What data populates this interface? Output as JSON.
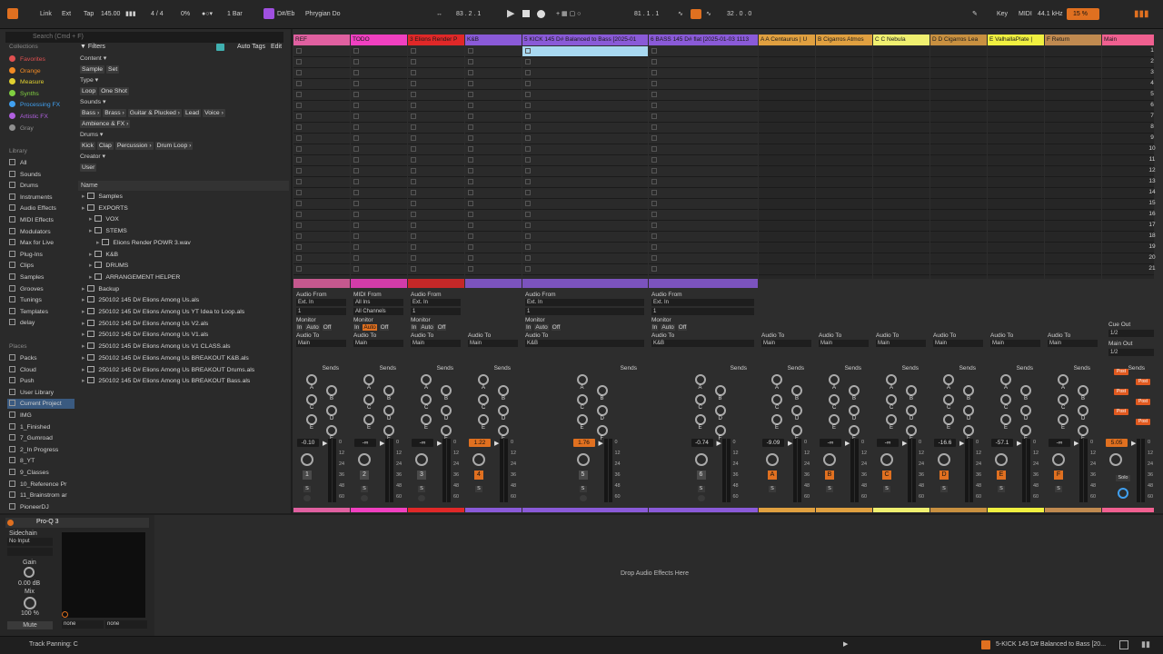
{
  "transport": {
    "link": "Link",
    "ext": "Ext",
    "tap": "Tap",
    "tempo": "145.00",
    "time_sig": "4 / 4",
    "cpu_pct": "0%",
    "quant": "1 Bar",
    "key": "D#/Eb",
    "scale": "Phrygian Do",
    "arr_pos": "83 .  2 .  1",
    "loop_start": "81 .  1 .  1",
    "loop_len": "32 .  0 .  0",
    "key_btn": "Key",
    "midi_btn": "MIDI",
    "sample_rate": "44.1 kHz",
    "cpu_load": "15 %"
  },
  "browser": {
    "search_placeholder": "Search (Cmd + F)",
    "collections_title": "Collections",
    "collections": [
      {
        "label": "Favorites",
        "color": "#e05050"
      },
      {
        "label": "Orange",
        "color": "#f08a24"
      },
      {
        "label": "Measure",
        "color": "#e0d030"
      },
      {
        "label": "Synths",
        "color": "#80d040"
      },
      {
        "label": "Processing FX",
        "color": "#40a0f0"
      },
      {
        "label": "Artistic FX",
        "color": "#b060e0"
      },
      {
        "label": "Gray",
        "color": "#909090"
      }
    ],
    "library_title": "Library",
    "library": [
      "All",
      "Sounds",
      "Drums",
      "Instruments",
      "Audio Effects",
      "MIDI Effects",
      "Modulators",
      "Max for Live",
      "Plug-Ins",
      "Clips",
      "Samples",
      "Grooves",
      "Tunings",
      "Templates",
      "delay"
    ],
    "places_title": "Places",
    "places": [
      "Packs",
      "Cloud",
      "Push",
      "User Library",
      "Current Project",
      "IMG",
      "1_Finished",
      "7_Gumroad",
      "2_In Progress",
      "8_YT",
      "9_Classes",
      "10_Reference Pr",
      "11_Brainstrom ar",
      "PioneerDJ"
    ],
    "filters_label": "Filters",
    "auto_tags": "Auto Tags",
    "edit": "Edit",
    "filters": [
      {
        "title": "Content ▾",
        "chips": [
          "Sample",
          "Set"
        ]
      },
      {
        "title": "Type ▾",
        "chips": [
          "Loop",
          "One Shot"
        ]
      },
      {
        "title": "Sounds ▾",
        "chips": [
          "Bass ›",
          "Brass ›",
          "Guitar & Plucked ›",
          "Lead",
          "Voice ›"
        ]
      },
      {
        "title": "",
        "chips": [
          "Ambience & FX ›"
        ]
      },
      {
        "title": "Drums ▾",
        "chips": [
          "Kick",
          "Clap",
          "Percussion ›",
          "Drum Loop ›"
        ]
      },
      {
        "title": "Creator ▾",
        "chips": [
          "User"
        ]
      }
    ],
    "name_header": "Name",
    "tree": [
      {
        "label": "Samples",
        "indent": 0
      },
      {
        "label": "EXPORTS",
        "indent": 0
      },
      {
        "label": "VOX",
        "indent": 1
      },
      {
        "label": "STEMS",
        "indent": 1
      },
      {
        "label": "Elions Render POWR 3.wav",
        "indent": 2
      },
      {
        "label": "K&B",
        "indent": 1
      },
      {
        "label": "DRUMS",
        "indent": 1
      },
      {
        "label": "ARRANGEMENT HELPER",
        "indent": 1
      },
      {
        "label": "Backup",
        "indent": 0
      },
      {
        "label": "250102 145 D# Elions Among Us.als",
        "indent": 0
      },
      {
        "label": "250102 145 D# Elions Among Us YT Idea to Loop.als",
        "indent": 0
      },
      {
        "label": "250102 145 D# Elions Among Us V2.als",
        "indent": 0
      },
      {
        "label": "250102 145 D# Elions Among Us V1.als",
        "indent": 0
      },
      {
        "label": "250102 145 D# Elions Among Us V1 CLASS.als",
        "indent": 0
      },
      {
        "label": "250102 145 D# Elions Among Us BREAKOUT K&B.als",
        "indent": 0
      },
      {
        "label": "250102 145 D# Elions Among Us BREAKOUT Drums.als",
        "indent": 0
      },
      {
        "label": "250102 145 D# Elions Among Us BREAKOUT Bass.als",
        "indent": 0
      }
    ]
  },
  "tracks": [
    {
      "name": "REF",
      "color": "#e060a0",
      "vol": "-0.10",
      "num": "1",
      "io": "audio",
      "in1": "Ext. In",
      "in2": "1",
      "out": "Main"
    },
    {
      "name": "TODO",
      "color": "#f040c0",
      "vol": "-∞",
      "num": "2",
      "io": "midi",
      "in1": "All Ins",
      "in2": "All Channels",
      "out": "Main"
    },
    {
      "name": "3 Elions Render P",
      "color": "#e02828",
      "vol": "-∞",
      "num": "3",
      "io": "audio",
      "in1": "Ext. In",
      "in2": "1",
      "out": "Main"
    },
    {
      "name": "K&B",
      "color": "#8a5ad8",
      "vol": "1.22",
      "num": "4",
      "io": "group",
      "out": "Main"
    },
    {
      "name": "5 KICK 145 D# Balanced to Bass [2025-01",
      "color": "#8a5ad8",
      "vol": "1.76",
      "num": "5",
      "io": "audio",
      "in1": "Ext. In",
      "in2": "1",
      "out": "K&B"
    },
    {
      "name": "6 BASS 145 D# flat [2025-01-03 1113",
      "color": "#8a5ad8",
      "vol": "-0.74",
      "num": "6",
      "io": "audio",
      "in1": "Ext. In",
      "in2": "1",
      "out": "K&B"
    },
    {
      "name": "A A Centaurus | U",
      "color": "#e0a040",
      "vol": "-9.09",
      "num": "A",
      "io": "return",
      "out": "Main"
    },
    {
      "name": "B Cigarros Atmos",
      "color": "#e0a040",
      "vol": "-∞",
      "num": "B",
      "io": "return",
      "out": "Main"
    },
    {
      "name": "C C Nebula",
      "color": "#f0f070",
      "vol": "-∞",
      "num": "C",
      "io": "return",
      "out": "Main"
    },
    {
      "name": "D D Cigarros Lea",
      "color": "#c89040",
      "vol": "-16.6",
      "num": "D",
      "io": "return",
      "out": "Main"
    },
    {
      "name": "E ValhallaPlate |",
      "color": "#f0f040",
      "vol": "-57.1",
      "num": "E",
      "io": "return",
      "out": "Main"
    },
    {
      "name": "F Return",
      "color": "#c08a50",
      "vol": "-∞",
      "num": "F",
      "io": "return",
      "out": "Main"
    },
    {
      "name": "Main",
      "color": "#f06090",
      "vol": "5.05",
      "num": "",
      "io": "main",
      "out": ""
    }
  ],
  "mixer_labels": {
    "audio_from": "Audio From",
    "midi_from": "MIDI From",
    "monitor": "Monitor",
    "in": "In",
    "auto": "Auto",
    "off": "Off",
    "audio_to": "Audio To",
    "sends": "Sends",
    "cue_out": "Cue Out",
    "cue_val": "1/2",
    "main_out": "Main Out",
    "main_val": "1/2",
    "post": "Post",
    "solo": "Solo",
    "s": "S",
    "send_letters": [
      "A",
      "B",
      "C",
      "D",
      "E",
      "F"
    ],
    "scale": [
      "0",
      "12",
      "24",
      "36",
      "48",
      "60"
    ]
  },
  "scene_numbers": [
    "1",
    "2",
    "3",
    "4",
    "5",
    "6",
    "7",
    "8",
    "9",
    "10",
    "11",
    "12",
    "13",
    "14",
    "15",
    "16",
    "17",
    "18",
    "19",
    "20",
    "21"
  ],
  "device": {
    "name": "Pro-Q 3",
    "sidechain": "Sidechain",
    "sc_input": "No Input",
    "gain_label": "Gain",
    "gain_val": "0.00 dB",
    "mix_label": "Mix",
    "mix_val": "100 %",
    "mute": "Mute",
    "none1": "none",
    "none2": "none",
    "drop_hint": "Drop Audio Effects Here"
  },
  "status": {
    "left": "Track Panning: C",
    "clip": "5-KICK 145 D# Balanced to Bass [20..."
  }
}
